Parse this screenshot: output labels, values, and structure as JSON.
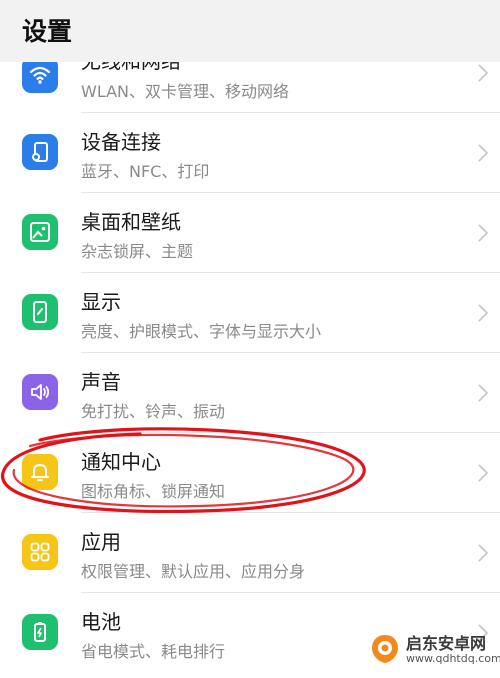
{
  "header": {
    "title": "设置"
  },
  "items": [
    {
      "title": "无线和网络",
      "subtitle": "WLAN、双卡管理、移动网络",
      "icon": "wifi-icon",
      "color": "#2b7de9"
    },
    {
      "title": "设备连接",
      "subtitle": "蓝牙、NFC、打印",
      "icon": "device-connection-icon",
      "color": "#2b7de9"
    },
    {
      "title": "桌面和壁纸",
      "subtitle": "杂志锁屏、主题",
      "icon": "wallpaper-icon",
      "color": "#1ec070"
    },
    {
      "title": "显示",
      "subtitle": "亮度、护眼模式、字体与显示大小",
      "icon": "display-icon",
      "color": "#1ec070"
    },
    {
      "title": "声音",
      "subtitle": "免打扰、铃声、振动",
      "icon": "sound-icon",
      "color": "#8a63e6"
    },
    {
      "title": "通知中心",
      "subtitle": "图标角标、锁屏通知",
      "icon": "bell-icon",
      "color": "#f5c518"
    },
    {
      "title": "应用",
      "subtitle": "权限管理、默认应用、应用分身",
      "icon": "apps-icon",
      "color": "#f5c518"
    },
    {
      "title": "电池",
      "subtitle": "省电模式、耗电排行",
      "icon": "battery-icon",
      "color": "#1ec070"
    }
  ],
  "watermark": {
    "name": "启东安卓网",
    "url": "www.qdhtdq.com"
  },
  "colors": {
    "annotation": "#e0131a",
    "header_bg": "#f2f2f2"
  }
}
